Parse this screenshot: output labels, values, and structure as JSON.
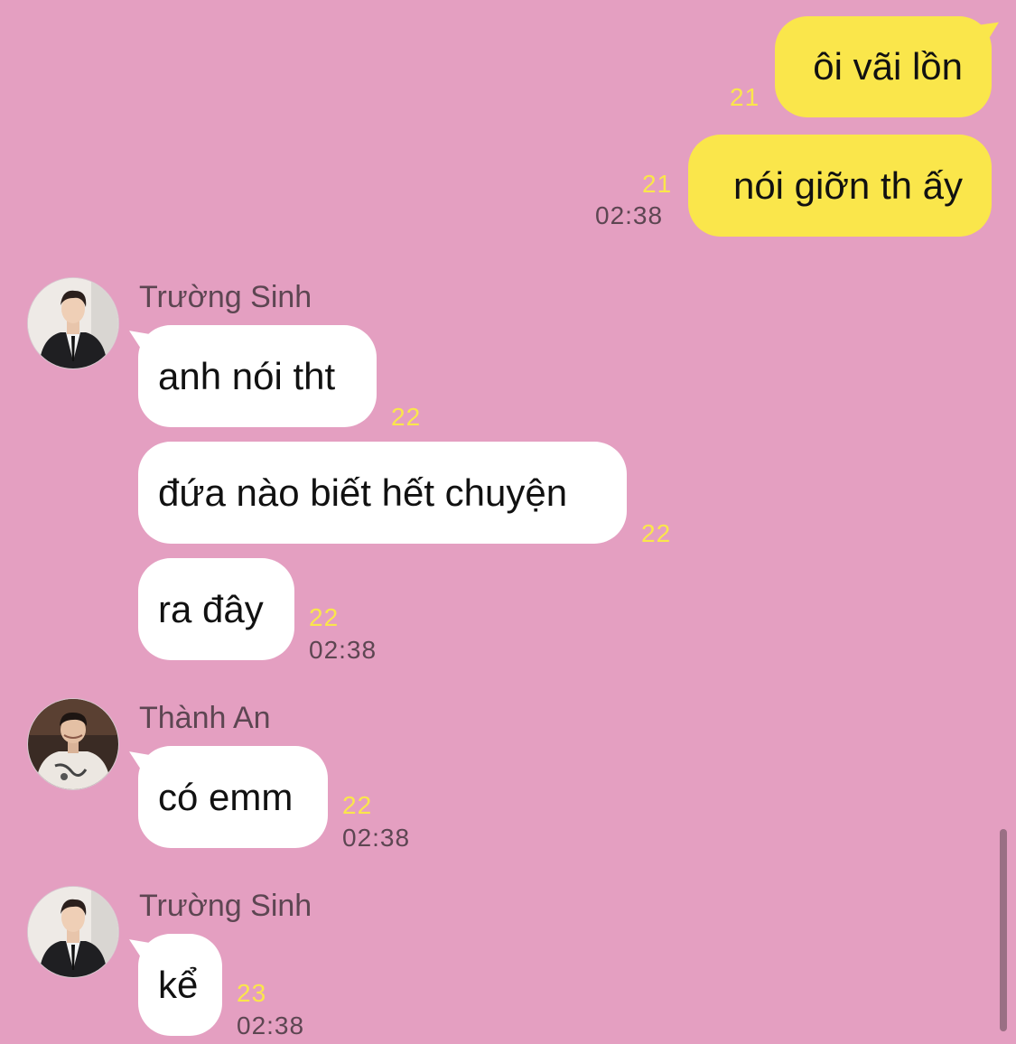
{
  "messages": {
    "m1": {
      "text": "ôi vãi lồn",
      "unread": "21"
    },
    "m2": {
      "text": "nói giỡn th ấy",
      "unread": "21",
      "time": "02:38"
    },
    "m3": {
      "text": "anh nói tht",
      "unread": "22"
    },
    "m4": {
      "text": "đứa nào biết hết chuyện",
      "unread": "22"
    },
    "m5": {
      "text": "ra đây",
      "unread": "22",
      "time": "02:38"
    },
    "m6": {
      "text": "có emm",
      "unread": "22",
      "time": "02:38"
    },
    "m7": {
      "text": "kể",
      "unread": "23",
      "time": "02:38"
    }
  },
  "senders": {
    "s1": {
      "name": "Trường Sinh"
    },
    "s2": {
      "name": "Thành An"
    },
    "s3": {
      "name": "Trường Sinh"
    }
  },
  "colors": {
    "background": "#e49fc1",
    "my_bubble": "#fae64b",
    "their_bubble": "#ffffff",
    "unread_count": "#fae64b",
    "timestamp": "#5d4652"
  },
  "icons": {
    "avatar1": "avatar-truong-sinh",
    "avatar2": "avatar-thanh-an",
    "avatar3": "avatar-truong-sinh"
  }
}
